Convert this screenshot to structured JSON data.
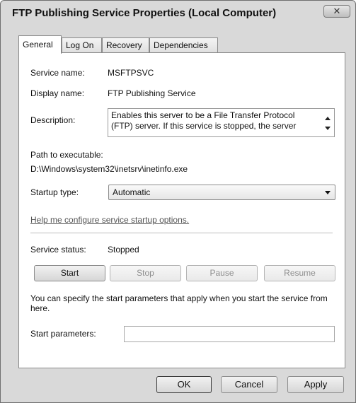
{
  "window": {
    "title": "FTP Publishing Service Properties (Local Computer)",
    "close_glyph": "✕"
  },
  "tabs": [
    "General",
    "Log On",
    "Recovery",
    "Dependencies"
  ],
  "general": {
    "service_name_label": "Service name:",
    "service_name": "MSFTPSVC",
    "display_name_label": "Display name:",
    "display_name": "FTP Publishing Service",
    "description_label": "Description:",
    "description": "Enables this server to be a File Transfer Protocol (FTP) server. If this service is stopped, the server",
    "path_label": "Path to executable:",
    "path": "D:\\Windows\\system32\\inetsrv\\inetinfo.exe",
    "startup_label": "Startup type:",
    "startup_value": "Automatic",
    "help_link": "Help me configure service startup options.",
    "status_label": "Service status:",
    "status_value": "Stopped",
    "buttons": {
      "start": "Start",
      "stop": "Stop",
      "pause": "Pause",
      "resume": "Resume"
    },
    "info": "You can specify the start parameters that apply when you start the service from here.",
    "params_label": "Start parameters:",
    "params_value": ""
  },
  "footer": {
    "ok": "OK",
    "cancel": "Cancel",
    "apply": "Apply"
  }
}
